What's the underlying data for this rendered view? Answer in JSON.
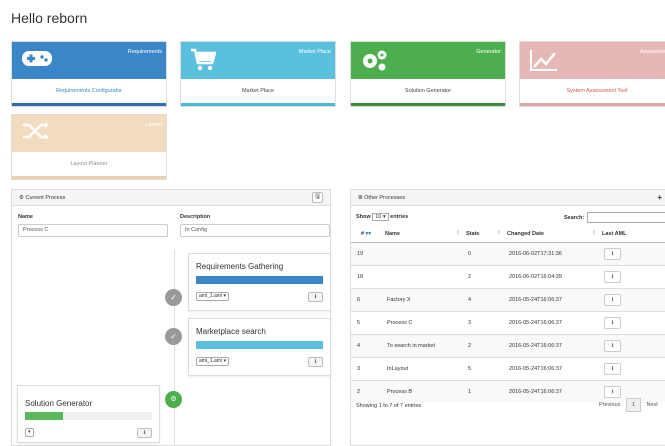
{
  "page": {
    "title": "Hello reborn"
  },
  "tiles": [
    {
      "name": "Requirements",
      "label": "Requirements Configurator",
      "icon": "gamepad-icon",
      "color": "#3a86c8",
      "bar": "#2a6db0",
      "label_color": "#3a86c8"
    },
    {
      "name": "Market Place",
      "label": "Market Place",
      "icon": "shopping-cart-icon",
      "color": "#5bc0de",
      "bar": "#46b8da",
      "label_color": "#444"
    },
    {
      "name": "Generator",
      "label": "Solution Generator",
      "icon": "gears-icon",
      "color": "#4cae4c",
      "bar": "#3d8b3d",
      "label_color": "#444"
    },
    {
      "name": "Assessment",
      "label": "System Assessment Tool",
      "icon": "line-chart-icon",
      "color": "#e6b7b7",
      "bar": "#dca7a7",
      "label_color": "#d9534f"
    },
    {
      "name": "Layout",
      "label": "Layout Planner",
      "icon": "random-icon",
      "color": "#f2dcc0",
      "bar": "#ecd0ad",
      "label_color": "#8a8a8a"
    }
  ],
  "current_process": {
    "header": "Current Process",
    "name_label": "Name",
    "name_value": "Process C",
    "description_label": "Description",
    "description_value": "In Config",
    "steps": [
      {
        "title": "Requirements Gathering",
        "select": "aml_1.aml",
        "progress": 1.0,
        "color": "#3a86c8",
        "status": "check"
      },
      {
        "title": "Marketplace search",
        "select": "aml_1.aml",
        "progress": 1.0,
        "color": "#5bc0de",
        "status": "check"
      },
      {
        "title": "Solution Generator",
        "select": "",
        "progress": 0.3,
        "color": "#5cb85c",
        "status": "gears"
      }
    ]
  },
  "other_processes": {
    "header": "Other Processes",
    "add_button": "+",
    "show_label": "Show",
    "entries_value": "10",
    "entries_label": "entries",
    "search_label": "Search:",
    "columns": [
      "#",
      "Name",
      "State",
      "Changed Date",
      "Last AML"
    ],
    "rows": [
      {
        "id": "19",
        "name": "",
        "state": "0",
        "date": "2016-06-02T17:31:36"
      },
      {
        "id": "18",
        "name": "",
        "state": "2",
        "date": "2016-06-02T16:04:39"
      },
      {
        "id": "6",
        "name": "Factory X",
        "state": "4",
        "date": "2016-05-24T16:06:37"
      },
      {
        "id": "5",
        "name": "Process C",
        "state": "3",
        "date": "2016-05-24T16:06:37"
      },
      {
        "id": "4",
        "name": "To search in market",
        "state": "2",
        "date": "2016-05-24T16:06:37"
      },
      {
        "id": "3",
        "name": "InLayout",
        "state": "5",
        "date": "2016-05-24T16:06:37"
      },
      {
        "id": "2",
        "name": "Process B",
        "state": "1",
        "date": "2016-05-24T16:06:37"
      }
    ],
    "info": "Showing 1 to 7 of 7 entries",
    "previous": "Previous",
    "page": "1",
    "next": "Next"
  }
}
